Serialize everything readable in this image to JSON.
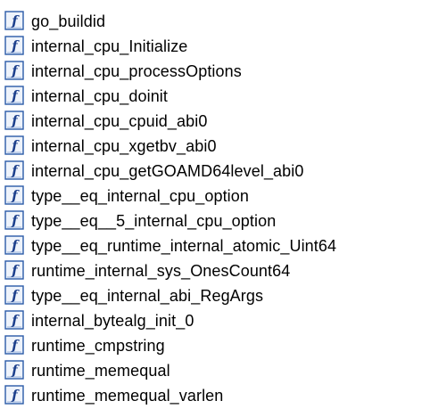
{
  "icon": {
    "name": "function-icon",
    "glyph": "f",
    "border_color": "#2a5aa8",
    "fill_color": "#eef3fb",
    "glyph_color": "#1c3f8c"
  },
  "functions": [
    {
      "name": "go_buildid"
    },
    {
      "name": "internal_cpu_Initialize"
    },
    {
      "name": "internal_cpu_processOptions"
    },
    {
      "name": "internal_cpu_doinit"
    },
    {
      "name": "internal_cpu_cpuid_abi0"
    },
    {
      "name": "internal_cpu_xgetbv_abi0"
    },
    {
      "name": "internal_cpu_getGOAMD64level_abi0"
    },
    {
      "name": "type__eq_internal_cpu_option"
    },
    {
      "name": "type__eq__5_internal_cpu_option"
    },
    {
      "name": "type__eq_runtime_internal_atomic_Uint64"
    },
    {
      "name": "runtime_internal_sys_OnesCount64"
    },
    {
      "name": "type__eq_internal_abi_RegArgs"
    },
    {
      "name": "internal_bytealg_init_0"
    },
    {
      "name": "runtime_cmpstring"
    },
    {
      "name": "runtime_memequal"
    },
    {
      "name": "runtime_memequal_varlen"
    }
  ]
}
